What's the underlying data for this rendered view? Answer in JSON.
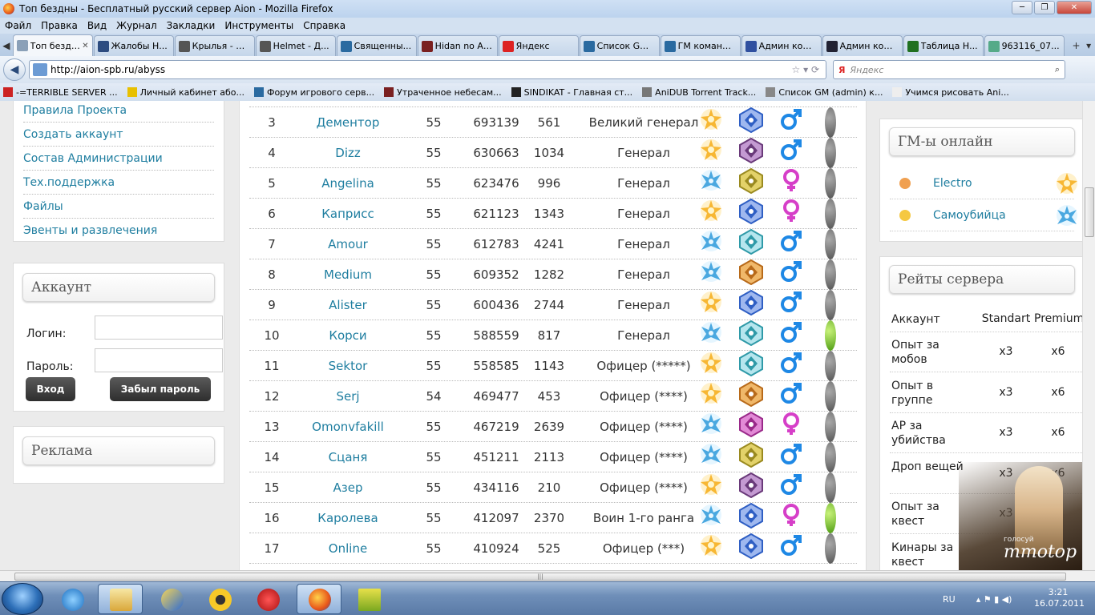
{
  "window": {
    "title": "Топ бездны - Бесплатный русский сервер Aion - Mozilla Firefox"
  },
  "menu": [
    "Файл",
    "Правка",
    "Вид",
    "Журнал",
    "Закладки",
    "Инструменты",
    "Справка"
  ],
  "tabs": [
    {
      "label": "Топ бездн...",
      "color": "#8aa0b8"
    },
    {
      "label": "Жалобы Н...",
      "color": "#2d4c80"
    },
    {
      "label": "Крылья - Д...",
      "color": "#555"
    },
    {
      "label": "Helmet - Д...",
      "color": "#555"
    },
    {
      "label": "Священны...",
      "color": "#2a6aa0"
    },
    {
      "label": "Hidan no Ar...",
      "color": "#7a2020"
    },
    {
      "label": "Яндекс",
      "color": "#d22"
    },
    {
      "label": "Список GM...",
      "color": "#2a6aa0"
    },
    {
      "label": "ГМ команд...",
      "color": "#2a6aa0"
    },
    {
      "label": "Админ ком...",
      "color": "#3050a0"
    },
    {
      "label": "Админ ком...",
      "color": "#223"
    },
    {
      "label": "Таблица Н...",
      "color": "#207020"
    },
    {
      "label": "963116_07...",
      "color": "#5a8"
    }
  ],
  "url": "http://aion-spb.ru/abyss",
  "search_placeholder": "Яндекс",
  "bookmarks": [
    "-=TERRIBLE SERVER ...",
    "Личный кабинет або...",
    "Форум игрового серв...",
    "Утраченное небесам...",
    "SINDIKAT - Главная ст...",
    "AniDUB Torrent Track...",
    "Список GM (admin) к...",
    "Учимся рисовать Ani..."
  ],
  "leftnav": [
    "Правила Проекта",
    "Создать аккаунт",
    "Состав Администрации",
    "Тех.поддержка",
    "Файлы",
    "Эвенты и развлечения"
  ],
  "account": {
    "title": "Аккаунт",
    "login_label": "Логин:",
    "password_label": "Пароль:",
    "login_button": "Вход",
    "forgot_button": "Забыл пароль"
  },
  "ads": {
    "title": "Реклама"
  },
  "ranking": [
    {
      "rank": "3",
      "name": "Дементор",
      "level": "55",
      "ap": "693139",
      "kills": "561",
      "title": "Великий генерал",
      "race": "elyos",
      "cls": "blue",
      "gender": "male",
      "online": false
    },
    {
      "rank": "4",
      "name": "Dizz",
      "level": "55",
      "ap": "630663",
      "kills": "1034",
      "title": "Генерал",
      "race": "elyos",
      "cls": "purple",
      "gender": "male",
      "online": false
    },
    {
      "rank": "5",
      "name": "Angelina",
      "level": "55",
      "ap": "623476",
      "kills": "996",
      "title": "Генерал",
      "race": "asmo",
      "cls": "olive",
      "gender": "female",
      "online": false
    },
    {
      "rank": "6",
      "name": "Каприсс",
      "level": "55",
      "ap": "621123",
      "kills": "1343",
      "title": "Генерал",
      "race": "elyos",
      "cls": "blue",
      "gender": "female",
      "online": false
    },
    {
      "rank": "7",
      "name": "Amour",
      "level": "55",
      "ap": "612783",
      "kills": "4241",
      "title": "Генерал",
      "race": "asmo",
      "cls": "teal",
      "gender": "male",
      "online": false
    },
    {
      "rank": "8",
      "name": "Medium",
      "level": "55",
      "ap": "609352",
      "kills": "1282",
      "title": "Генерал",
      "race": "asmo",
      "cls": "orange",
      "gender": "male",
      "online": false
    },
    {
      "rank": "9",
      "name": "Alister",
      "level": "55",
      "ap": "600436",
      "kills": "2744",
      "title": "Генерал",
      "race": "elyos",
      "cls": "blue",
      "gender": "male",
      "online": false
    },
    {
      "rank": "10",
      "name": "Корси",
      "level": "55",
      "ap": "588559",
      "kills": "817",
      "title": "Генерал",
      "race": "asmo",
      "cls": "teal",
      "gender": "male",
      "online": true
    },
    {
      "rank": "11",
      "name": "Sektor",
      "level": "55",
      "ap": "558585",
      "kills": "1143",
      "title": "Офицер (*****)",
      "race": "elyos",
      "cls": "teal",
      "gender": "male",
      "online": false
    },
    {
      "rank": "12",
      "name": "Serj",
      "level": "54",
      "ap": "469477",
      "kills": "453",
      "title": "Офицер (****)",
      "race": "elyos",
      "cls": "orange",
      "gender": "male",
      "online": false
    },
    {
      "rank": "13",
      "name": "Omonvfakill",
      "level": "55",
      "ap": "467219",
      "kills": "2639",
      "title": "Офицер (****)",
      "race": "asmo",
      "cls": "magenta",
      "gender": "female",
      "online": false
    },
    {
      "rank": "14",
      "name": "Сцаня",
      "level": "55",
      "ap": "451211",
      "kills": "2113",
      "title": "Офицер (****)",
      "race": "asmo",
      "cls": "olive",
      "gender": "male",
      "online": false
    },
    {
      "rank": "15",
      "name": "Азер",
      "level": "55",
      "ap": "434116",
      "kills": "210",
      "title": "Офицер (****)",
      "race": "elyos",
      "cls": "purple",
      "gender": "male",
      "online": false
    },
    {
      "rank": "16",
      "name": "Каролева",
      "level": "55",
      "ap": "412097",
      "kills": "2370",
      "title": "Воин 1-го ранга",
      "race": "asmo",
      "cls": "blue",
      "gender": "female",
      "online": true
    },
    {
      "rank": "17",
      "name": "Online",
      "level": "55",
      "ap": "410924",
      "kills": "525",
      "title": "Офицер (***)",
      "race": "elyos",
      "cls": "blue",
      "gender": "male",
      "online": false
    }
  ],
  "gm_online": {
    "title": "ГМ-ы онлайн",
    "items": [
      {
        "name": "Electro",
        "dot": "#f0a050",
        "race": "elyos"
      },
      {
        "name": "Самоубийца",
        "dot": "#f5c842",
        "race": "asmo"
      }
    ]
  },
  "rates": {
    "title": "Рейты сервера",
    "header": {
      "k": "Аккаунт",
      "a": "Standart",
      "b": "Premium"
    },
    "rows": [
      {
        "k": "Опыт за мобов",
        "a": "x3",
        "b": "x6"
      },
      {
        "k": "Опыт в группе",
        "a": "x3",
        "b": "x6"
      },
      {
        "k": "АР за убийства",
        "a": "x3",
        "b": "x6"
      },
      {
        "k": "Дроп вещей",
        "a": "x3",
        "b": "x6"
      },
      {
        "k": "Опыт за квест",
        "a": "x3",
        "b": ""
      },
      {
        "k": "Кинары за квест",
        "a": "",
        "b": ""
      }
    ]
  },
  "mmotop": {
    "top": "голосуй",
    "logo": "mmotop"
  },
  "taskbar": {
    "lang": "RU",
    "time": "3:21",
    "date": "16.07.2011"
  },
  "colors": {
    "link": "#1f7ea0",
    "online": "#5fb21d",
    "offline": "#666666",
    "male": "#1e88e5",
    "female": "#d63fc8"
  }
}
